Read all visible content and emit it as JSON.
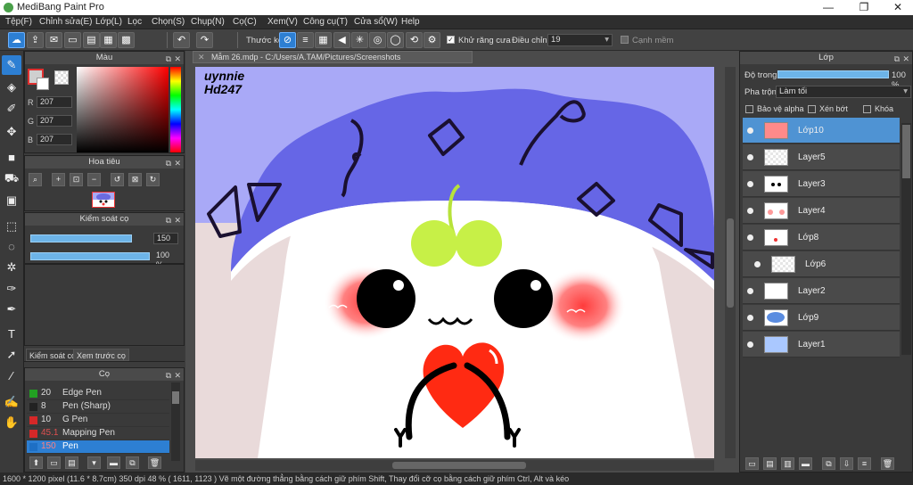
{
  "window": {
    "title": "MediBang Paint Pro",
    "controls": [
      "—",
      "❐",
      "✕"
    ]
  },
  "menu": [
    "Tệp(F)",
    "Chỉnh sửa(E)",
    "Lớp(L)",
    "Lọc",
    "Chọn(S)",
    "Chụp(N)",
    "Cọ(C)",
    "Xem(V)",
    "Công cụ(T)",
    "Cửa sổ(W)",
    "Help"
  ],
  "toolbar": {
    "ruler_label": "Thước kẻ",
    "antialias_label": "Khử răng cưa",
    "antialias_checked": true,
    "correction_label": "Điều chỉnh",
    "correction_value": "19",
    "soft_edge_label": "Cạnh mềm",
    "soft_edge_checked": false
  },
  "color_panel": {
    "title": "Màu",
    "r_label": "R",
    "g_label": "G",
    "b_label": "B",
    "r": "207",
    "g": "207",
    "b": "207",
    "fg_color": "#cfcfcf"
  },
  "navigator_panel": {
    "title": "Hoa tiêu"
  },
  "brush_control_panel": {
    "title": "Kiểm soát cọ",
    "size": "150",
    "opacity": "100 %",
    "size_fraction": 0.85,
    "opacity_fraction": 1.0
  },
  "sub_tabs": [
    "Kiểm soát cọ",
    "Xem trước cọ"
  ],
  "brush_list_panel": {
    "title": "Cọ",
    "items": [
      {
        "size": "20",
        "name": "Edge Pen",
        "color": "#22a022"
      },
      {
        "size": "8",
        "name": "Pen (Sharp)",
        "color": "#222222"
      },
      {
        "size": "10",
        "name": "G Pen",
        "color": "#d62828"
      },
      {
        "size": "45.1",
        "name": "Mapping Pen",
        "color": "#d62828"
      },
      {
        "size": "150",
        "name": "Pen",
        "color": "#1e6fc4"
      }
    ]
  },
  "document": {
    "tab_label": "Mẫm 26.mdp - C:/Users/A.TAM/Pictures/Screenshots",
    "tab_close": "✕",
    "signature_text": "uynnie Hd247"
  },
  "layer_panel": {
    "title": "Lớp",
    "opacity_label": "Độ trong",
    "opacity_value": "100 %",
    "opacity_fraction": 1.0,
    "blend_label": "Pha trộn",
    "blend_value": "Làm tối",
    "protect_alpha_label": "Bảo vệ alpha",
    "clipping_label": "Xén bớt",
    "lock_label": "Khóa",
    "layers": [
      {
        "name": "Lớp10",
        "selected": true,
        "thumb": "pink"
      },
      {
        "name": "Layer5",
        "selected": false,
        "thumb": "empty"
      },
      {
        "name": "Layer3",
        "selected": false,
        "thumb": "eyes"
      },
      {
        "name": "Layer4",
        "selected": false,
        "thumb": "blush"
      },
      {
        "name": "Lớp8",
        "selected": false,
        "thumb": "heart"
      },
      {
        "name": "Lớp6",
        "selected": false,
        "thumb": "empty",
        "indented": true
      },
      {
        "name": "Layer2",
        "selected": false,
        "thumb": "white"
      },
      {
        "name": "Lớp9",
        "selected": false,
        "thumb": "cloud"
      },
      {
        "name": "Layer1",
        "selected": false,
        "thumb": "lightblue"
      }
    ]
  },
  "status": "1600 * 1200 pixel  (11.6 * 8.7cm)  350 dpi  48 %  ( 1611, 1123 )  Vẽ một đường thẳng bằng cách giữ phím Shift, Thay đổi cỡ cọ bằng cách giữ phím Ctrl, Alt và kéo"
}
